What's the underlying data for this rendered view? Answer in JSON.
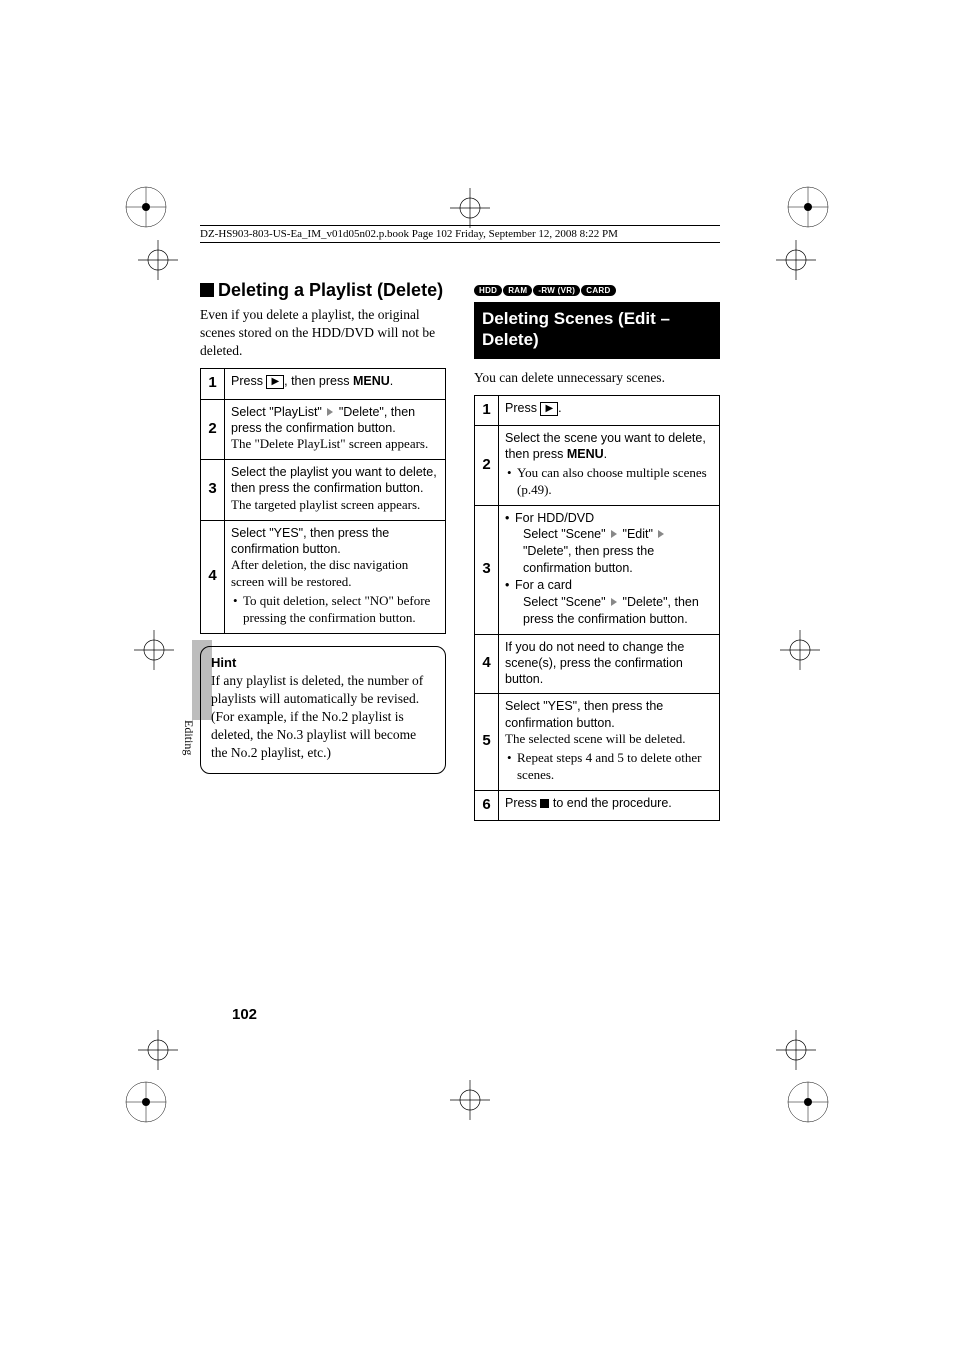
{
  "header": {
    "running_head": "DZ-HS903-803-US-Ea_IM_v01d05n02.p.book  Page 102  Friday, September 12, 2008  8:22 PM"
  },
  "sidebar_tab": "Editing",
  "page_number": "102",
  "left": {
    "heading": "Deleting a Playlist (Delete)",
    "intro": "Even if you delete a playlist, the original scenes stored on the HDD/DVD will not be deleted.",
    "steps": {
      "n1": "1",
      "s1_a": "Press ",
      "s1_b": ", then press ",
      "s1_c": "MENU",
      "s1_d": ".",
      "n2": "2",
      "s2_a": "Select \"PlayList\"",
      "s2_b": "\"Delete\", then press the confirmation button.",
      "s2_sub": "The \"Delete PlayList\" screen appears.",
      "n3": "3",
      "s3_a": "Select the playlist you want to delete, then press the confirmation button.",
      "s3_sub": "The targeted playlist screen appears.",
      "n4": "4",
      "s4_a": "Select \"YES\", then press the confirmation button.",
      "s4_sub": "After deletion, the disc navigation screen will be restored.",
      "s4_bul": "To quit deletion, select \"NO\" before pressing the confirmation button."
    },
    "hint": {
      "title": "Hint",
      "body": "If any playlist is deleted, the number of playlists will automatically be revised. (For example, if the No.2 playlist is deleted, the No.3 playlist will become the No.2 playlist, etc.)"
    }
  },
  "right": {
    "badges": {
      "b1": "HDD",
      "b2": "RAM",
      "b3": "-RW (VR)",
      "b4": "CARD"
    },
    "heading": "Deleting Scenes (Edit – Delete)",
    "intro": "You can delete unnecessary scenes.",
    "steps": {
      "n1": "1",
      "s1_a": "Press ",
      "s1_b": ".",
      "n2": "2",
      "s2_a": "Select the scene you want to delete, then press ",
      "s2_b": "MENU",
      "s2_c": ".",
      "s2_bul": "You can also choose multiple scenes (p.49).",
      "n3": "3",
      "s3_hdd": "For HDD/DVD",
      "s3_hdd_a": "Select \"Scene\"",
      "s3_hdd_b": "\"Edit\"",
      "s3_hdd_c": "\"Delete\", then press the confirmation button.",
      "s3_card": "For a card",
      "s3_card_a": "Select \"Scene\"",
      "s3_card_b": "\"Delete\", then press the confirmation button.",
      "n4": "4",
      "s4": "If you do not need to change the scene(s), press the confirmation button.",
      "n5": "5",
      "s5_a": "Select \"YES\", then press the confirmation button.",
      "s5_sub": "The selected scene will be deleted.",
      "s5_bul": "Repeat steps 4 and 5 to delete other scenes.",
      "n6": "6",
      "s6_a": "Press ",
      "s6_b": " to end the procedure."
    }
  }
}
